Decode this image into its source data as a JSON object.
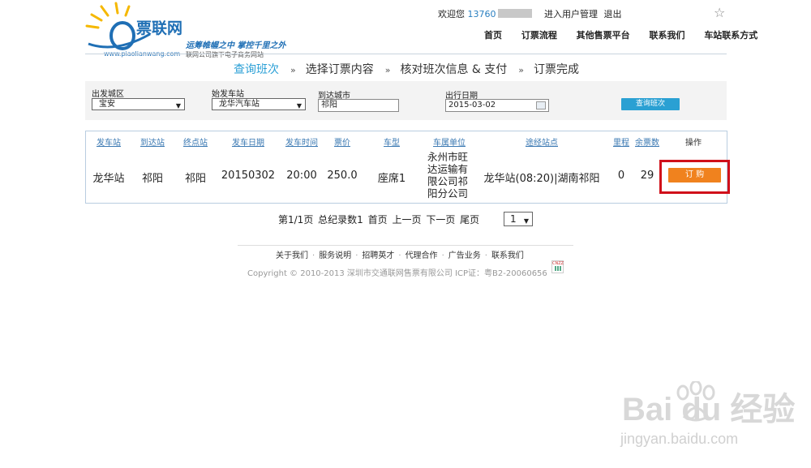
{
  "brand": {
    "name": "票联网",
    "url": "www.piaolianwang.com",
    "slogan": "运筹帷幄之中 掌控千里之外",
    "subtitle": "联网公司旗下电子商务网站"
  },
  "topbar": {
    "welcome": "欢迎您",
    "phone": "13760",
    "user_manage": "进入用户管理",
    "logout": "退出"
  },
  "nav": [
    "首页",
    "订票流程",
    "其他售票平台",
    "联系我们",
    "车站联系方式"
  ],
  "steps": {
    "items": [
      "查询班次",
      "选择订票内容",
      "核对班次信息 & 支付",
      "订票完成"
    ],
    "arrow": "»",
    "active_index": 0
  },
  "search": {
    "from_city_label": "出发城区",
    "from_city_value": "宝安",
    "station_label": "始发车站",
    "station_value": "龙华汽车站",
    "to_city_label": "到达城市",
    "to_city_value": "祁阳",
    "date_label": "出行日期",
    "date_value": "2015-03-02",
    "query_button": "查询班次"
  },
  "table": {
    "headers": [
      "发车站",
      "到达站",
      "终点站",
      "发车日期",
      "发车时间",
      "票价",
      "车型",
      "车属单位",
      "途经站点",
      "里程",
      "余票数",
      "操作"
    ],
    "rows": [
      {
        "from": "龙华站",
        "to": "祁阳",
        "terminal": "祁阳",
        "date": "20150302",
        "time": "20:00",
        "price": "250.0",
        "type": "座席1",
        "company": "永州市旺达运输有限公司祁阳分公司",
        "via": "龙华站(08:20)|湖南祁阳",
        "mileage": "0",
        "remaining": "29",
        "action": "订 购"
      }
    ]
  },
  "pager": {
    "page_info": "第1/1页",
    "total": "总纪录数1",
    "first": "首页",
    "prev": "上一页",
    "next": "下一页",
    "last": "尾页",
    "current": "1"
  },
  "footer": {
    "links": [
      "关于我们",
      "服务说明",
      "招聘英才",
      "代理合作",
      "广告业务",
      "联系我们"
    ],
    "copyright": "Copyright © 2010-2013 深圳市交通联网售票有限公司 ICP证：粤B2-20060656",
    "cnzz": "CNZZ"
  },
  "watermark": {
    "text": "Bai du 经验",
    "url": "jingyan.baidu.com"
  },
  "colors": {
    "accent": "#2a9fd6",
    "buy_button": "#f0821e",
    "highlight_box": "#d0101a"
  }
}
